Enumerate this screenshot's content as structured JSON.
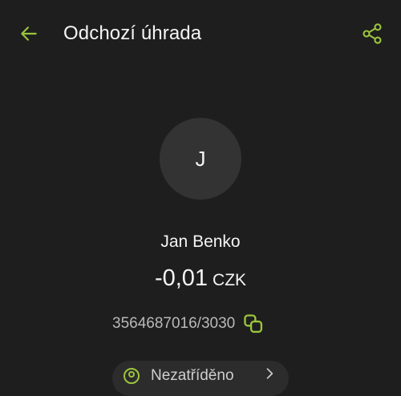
{
  "header": {
    "title": "Odchozí úhrada",
    "back_icon": "arrow-left-icon",
    "share_icon": "share-icon"
  },
  "counterparty": {
    "avatar_initial": "J",
    "name": "Jan Benko"
  },
  "amount": {
    "value": "-0,01",
    "currency": "CZK"
  },
  "account": {
    "number": "3564687016/3030",
    "copy_icon": "copy-icon"
  },
  "category": {
    "label": "Nezatříděno",
    "icon": "tag-icon"
  },
  "colors": {
    "background": "#1e1e1e",
    "accent": "#9bc53d",
    "avatar_bg": "#333333",
    "text_primary": "#f5f5f5",
    "text_secondary": "#b9b9b9"
  }
}
